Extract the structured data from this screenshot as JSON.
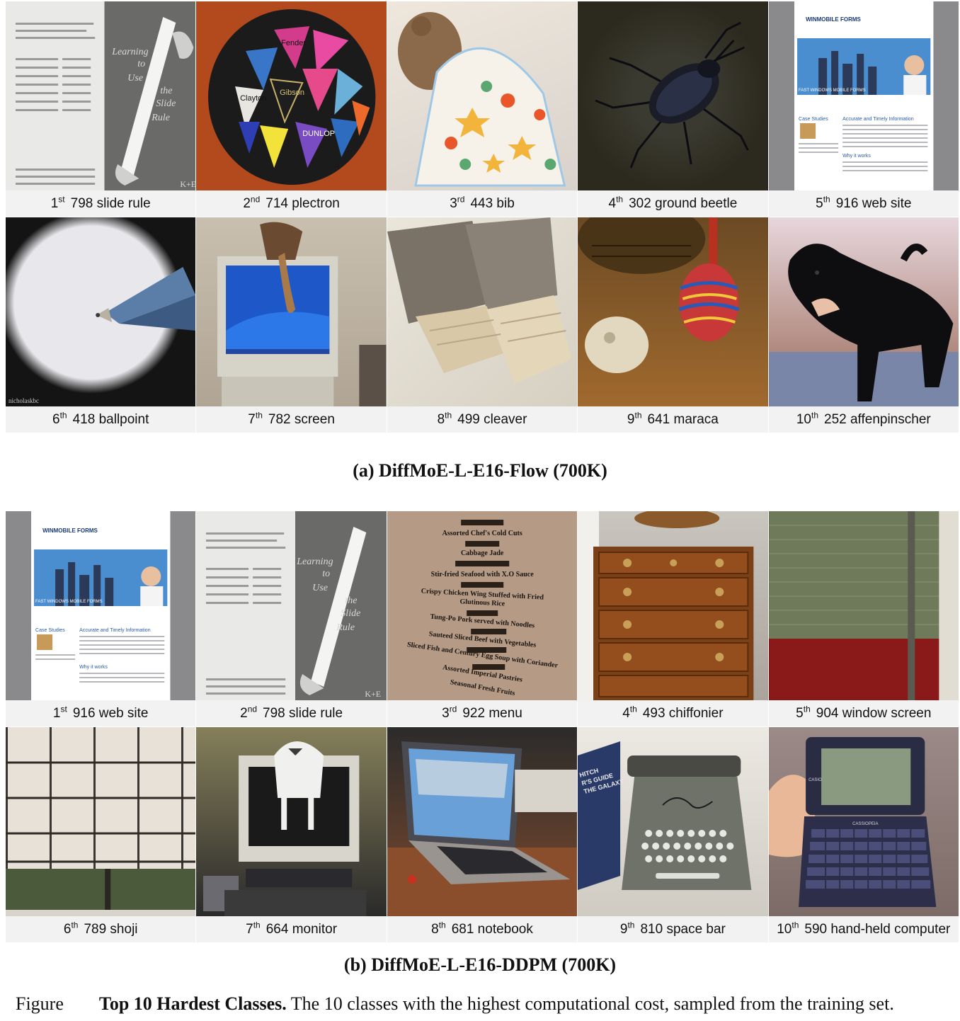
{
  "panel_a": {
    "subcaption": "(a) DiffMoE-L-E16-Flow (700K)",
    "cells": [
      {
        "rank_num": "1",
        "rank_suffix": "st",
        "label": "798  slide rule",
        "icon": "slide-rule-image",
        "image_text": [
          "Learning",
          "to",
          "Use",
          "the",
          "Slide",
          "Rule",
          "K+E"
        ]
      },
      {
        "rank_num": "2",
        "rank_suffix": "nd",
        "label": "714  plectron",
        "icon": "guitar-picks-image",
        "image_text": [
          "Fender",
          "Gibson",
          "Clayton",
          "DUNLOP"
        ]
      },
      {
        "rank_num": "3",
        "rank_suffix": "rd",
        "label": "443 bib",
        "icon": "bib-image"
      },
      {
        "rank_num": "4",
        "rank_suffix": "th",
        "label": "302 ground beetle",
        "icon": "beetle-image"
      },
      {
        "rank_num": "5",
        "rank_suffix": "th",
        "label": "916 web site",
        "icon": "website-image",
        "image_text": [
          "WINMOBILE FORMS",
          "FAST WINDOWS MOBILE FORMS",
          "Case Studies",
          "Accurate and Timely Information",
          "Why it works"
        ]
      },
      {
        "rank_num": "6",
        "rank_suffix": "th",
        "label": "418 ballpoint",
        "icon": "ballpoint-image",
        "image_text": [
          "nicholaskbc"
        ]
      },
      {
        "rank_num": "7",
        "rank_suffix": "th",
        "label": "782 screen",
        "icon": "crt-screen-image"
      },
      {
        "rank_num": "8",
        "rank_suffix": "th",
        "label": "499 cleaver",
        "icon": "cleaver-image"
      },
      {
        "rank_num": "9",
        "rank_suffix": "th",
        "label": "641 maraca",
        "icon": "maraca-image"
      },
      {
        "rank_num": "10",
        "rank_suffix": "th",
        "label": "252 affenpinscher",
        "icon": "dog-image"
      }
    ]
  },
  "panel_b": {
    "subcaption": "(b) DiffMoE-L-E16-DDPM (700K)",
    "cells": [
      {
        "rank_num": "1",
        "rank_suffix": "st",
        "label": "916 web site",
        "icon": "website-image",
        "image_text": [
          "WINMOBILE FORMS",
          "FAST WINDOWS MOBILE FORMS",
          "Case Studies",
          "Accurate and Timely Information",
          "Why it works"
        ]
      },
      {
        "rank_num": "2",
        "rank_suffix": "nd",
        "label": "798  slide rule",
        "icon": "slide-rule-image",
        "image_text": [
          "Learning",
          "to",
          "Use",
          "the",
          "Slide",
          "Rule",
          "K+E"
        ]
      },
      {
        "rank_num": "3",
        "rank_suffix": "rd",
        "label": "922 menu",
        "icon": "menu-image",
        "image_text": [
          "Assorted Chef's Cold Cuts",
          "Cabbage Jade",
          "Stir-fried Seafood with X.O Sauce",
          "Crispy Chicken Wing Stuffed with Fried Glutinous Rice",
          "Tung-Po Pork served with Noodles",
          "Sauteed Sliced Beef with Vegetables",
          "Sliced Fish and Century Egg Soup with Coriander",
          "Assorted Imperial Pastries",
          "Seasonal Fresh Fruits"
        ]
      },
      {
        "rank_num": "4",
        "rank_suffix": "th",
        "label": "493 chiffonier",
        "icon": "chiffonier-image"
      },
      {
        "rank_num": "5",
        "rank_suffix": "th",
        "label": "904 window screen",
        "icon": "window-screen-image"
      },
      {
        "rank_num": "6",
        "rank_suffix": "th",
        "label": "789 shoji",
        "icon": "shoji-image"
      },
      {
        "rank_num": "7",
        "rank_suffix": "th",
        "label": "664 monitor",
        "icon": "monitor-image"
      },
      {
        "rank_num": "8",
        "rank_suffix": "th",
        "label": "681 notebook",
        "icon": "notebook-image"
      },
      {
        "rank_num": "9",
        "rank_suffix": "th",
        "label": "810 space bar",
        "icon": "typewriter-image",
        "image_text": [
          "HITCH",
          "R'S GUIDE",
          "THE GALAXY"
        ]
      },
      {
        "rank_num": "10",
        "rank_suffix": "th",
        "label": "590 hand-held computer",
        "icon": "handheld-computer-image",
        "image_text": [
          "CASIO",
          "CASSIOPEIA"
        ]
      }
    ]
  },
  "figure_caption": {
    "figure_word": "Figure",
    "bold": "Top 10 Hardest Classes.",
    "rest": " The 10 classes with the highest computational cost, sampled from the training set."
  },
  "colors": {
    "label_bar_bg": "#f2f2f2",
    "text": "#111111"
  }
}
